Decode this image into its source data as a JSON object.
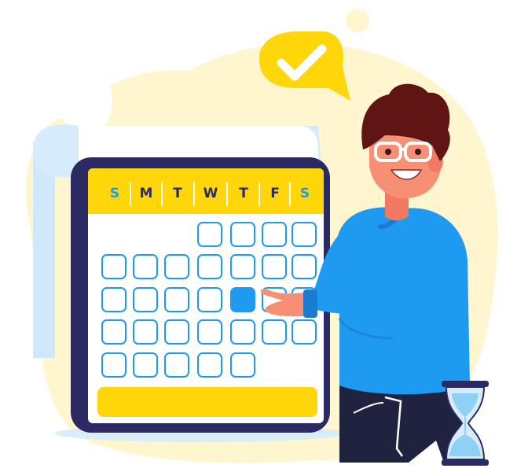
{
  "calendar": {
    "weekdays": [
      {
        "label": "S",
        "color": "#1aa0e0"
      },
      {
        "label": "M",
        "color": "#2b2a63"
      },
      {
        "label": "T",
        "color": "#2b2a63"
      },
      {
        "label": "W",
        "color": "#2b2a63"
      },
      {
        "label": "T",
        "color": "#2b2a63"
      },
      {
        "label": "F",
        "color": "#2b2a63"
      },
      {
        "label": "S",
        "color": "#1aa0e0"
      }
    ],
    "highlighted_day": "selected-day",
    "header_color": "#ffd60a",
    "frame_color": "#2b2a63"
  },
  "speech_bubble": {
    "icon": "checkmark-icon",
    "color": "#ffd60a"
  },
  "person": {
    "shirt_color": "#1e9bf0",
    "pants_color": "#1f2340"
  },
  "hourglass": {
    "icon": "hourglass-icon"
  }
}
